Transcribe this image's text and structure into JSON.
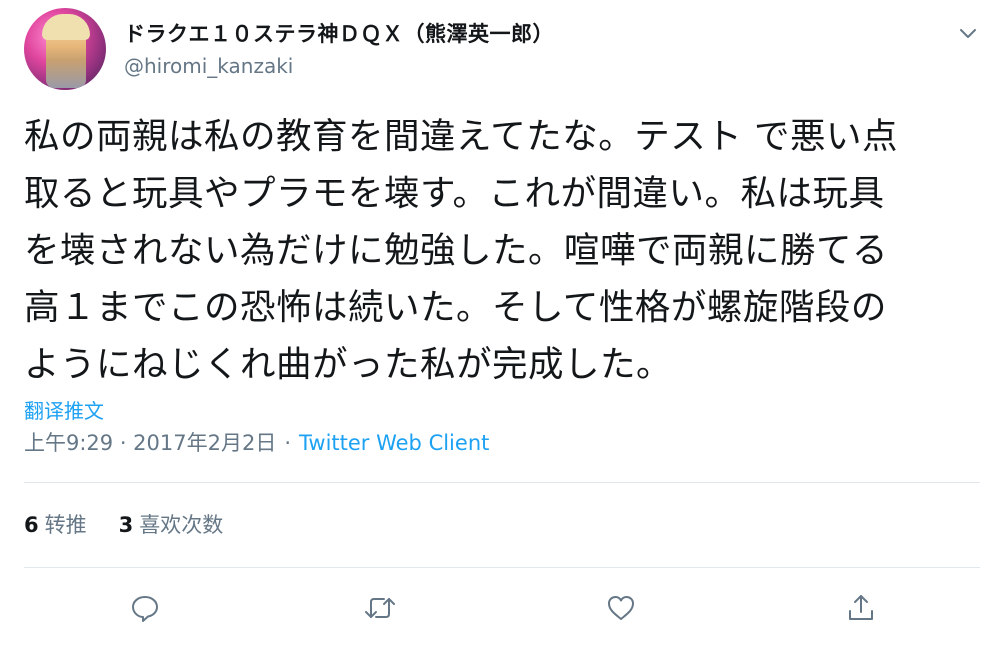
{
  "tweet": {
    "display_name": "ドラクエ１０ステラ神ＤＱＸ（熊澤英一郎）",
    "handle": "@hiromi_kanzaki",
    "text": "私の両親は私の教育を間違えてたな。テスト で悪い点\n取ると玩具やプラモを壊す。これが間違い。私は玩具\nを壊されない為だけに勉強した。喧嘩で両親に勝てる\n高１までこの恐怖は続いた。そして性格が螺旋階段の\nようにねじくれ曲がった私が完成した。",
    "translate_label": "翻译推文",
    "timestamp": "上午9:29 · 2017年2月2日",
    "separator": "·",
    "source": "Twitter Web Client",
    "retweet_count": "6",
    "retweet_label": "转推",
    "like_count": "3",
    "like_label": "喜欢次数"
  },
  "icons": {
    "caret": "chevron-down-icon",
    "reply": "reply-icon",
    "retweet": "retweet-icon",
    "like": "heart-icon",
    "share": "share-icon"
  },
  "colors": {
    "link": "#1da1f2",
    "secondary_text": "#657786",
    "divider": "#e1e8ed"
  }
}
